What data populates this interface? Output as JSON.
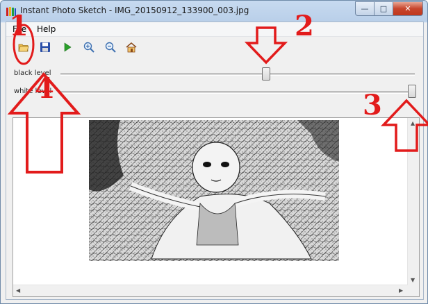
{
  "window": {
    "title": "Instant Photo Sketch - IMG_20150912_133900_003.jpg",
    "controls": {
      "minimize": "—",
      "maximize": "□",
      "close": "✕"
    }
  },
  "menu": {
    "file": "File",
    "help": "Help"
  },
  "toolbar": {
    "buttons": [
      {
        "name": "open",
        "icon": "folder-open-icon"
      },
      {
        "name": "save",
        "icon": "floppy-disk-icon"
      },
      {
        "name": "run",
        "icon": "play-icon"
      },
      {
        "name": "zoom-in",
        "icon": "zoom-in-icon"
      },
      {
        "name": "zoom-out",
        "icon": "zoom-out-icon"
      },
      {
        "name": "home",
        "icon": "home-icon"
      }
    ]
  },
  "sliders": {
    "black_level": {
      "label": "black level",
      "value_fraction": 0.58
    },
    "white_level": {
      "label": "white level",
      "value_fraction": 1.0
    }
  },
  "annotations": {
    "n1": "1",
    "n2": "2",
    "n3": "3",
    "n4": "4",
    "color": "#e21b1b"
  },
  "image": {
    "content": "pencil-sketch of a baby lying on a blanket"
  }
}
